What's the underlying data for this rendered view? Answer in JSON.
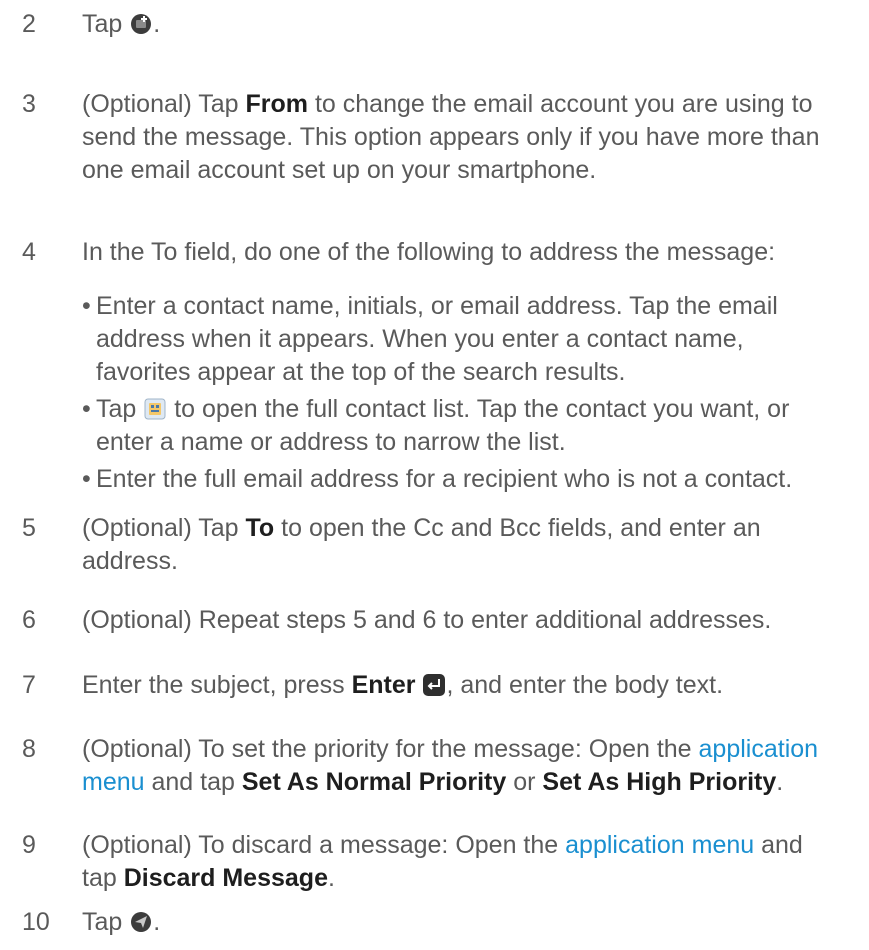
{
  "steps": [
    {
      "num": "2",
      "pre": "Tap ",
      "post": ".",
      "icon": "compose-icon"
    },
    {
      "num": "3",
      "a": "(Optional) Tap ",
      "b": "From",
      "c": " to change the email account you are using to send the message. This option appears only if you have more than one email account set up on your smartphone."
    },
    {
      "num": "4",
      "text": "In the To field, do one of the following to address the message:",
      "bullets": {
        "b1": "Enter a contact name, initials, or email address. Tap the email address when it appears. When you enter a contact name, favorites appear at the top of the search results.",
        "b2_pre": "Tap ",
        "b2_post": " to open the full contact list. Tap the contact you want, or enter a name or address to narrow the list.",
        "b3": "Enter the full email address for a recipient who is not a contact."
      }
    },
    {
      "num": "5",
      "a": "(Optional) Tap ",
      "b": "To",
      "c": " to open the Cc and Bcc fields, and enter an address."
    },
    {
      "num": "6",
      "text": "(Optional) Repeat steps 5 and 6 to enter additional addresses."
    },
    {
      "num": "7",
      "a": "Enter the subject, press ",
      "b": "Enter",
      "c": ", and enter the body text."
    },
    {
      "num": "8",
      "a": "(Optional) To set the priority for the message: Open the ",
      "link": "application menu",
      "c": " and tap ",
      "b1": "Set As Normal Priority",
      "d": " or ",
      "b2": "Set As High Priority",
      "e": "."
    },
    {
      "num": "9",
      "a": "(Optional) To discard a message: Open the ",
      "link": "application menu",
      "c": " and tap ",
      "b": "Discard Message",
      "e": "."
    },
    {
      "num": "10",
      "pre": "Tap ",
      "post": ".",
      "icon": "send-icon"
    }
  ],
  "colors": {
    "text": "#5a5a5a",
    "bold": "#1e1e1e",
    "link": "#1a8fd0"
  }
}
